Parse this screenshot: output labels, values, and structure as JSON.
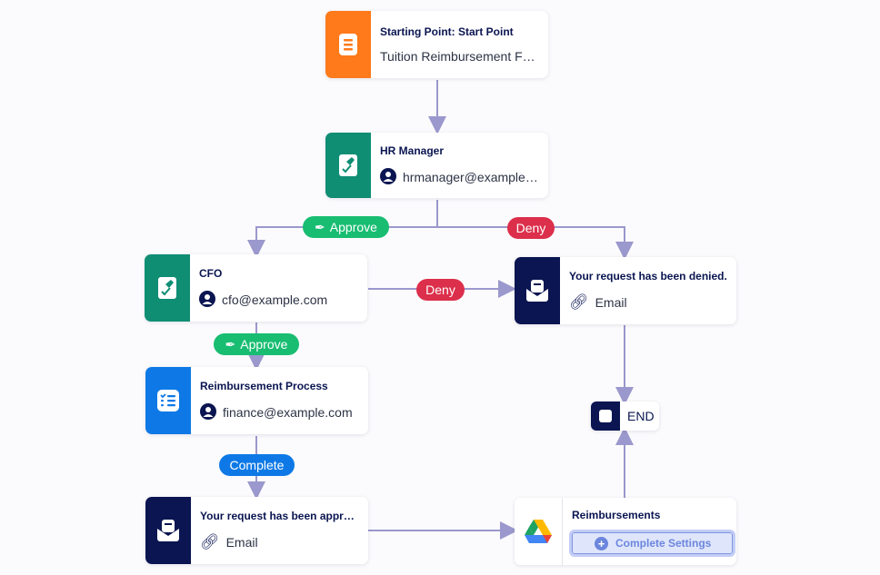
{
  "nodes": {
    "start": {
      "title": "Starting Point: Start Point",
      "subtitle": "Tuition Reimbursement Fo...",
      "icon": "form-icon",
      "color": "#ff7a1a"
    },
    "hr": {
      "title": "HR Manager",
      "subtitle": "hrmanager@example....",
      "icon": "approval-icon",
      "color": "#0f8e74"
    },
    "cfo": {
      "title": "CFO",
      "subtitle": "cfo@example.com",
      "icon": "approval-icon",
      "color": "#0f8e74"
    },
    "denied": {
      "title": "Your request has been denied.",
      "subtitle": "Email",
      "icon": "email-icon",
      "color": "#0a1551"
    },
    "process": {
      "title": "Reimbursement Process",
      "subtitle": "finance@example.com",
      "icon": "task-list-icon",
      "color": "#0e79e6"
    },
    "approved": {
      "title": "Your request has been appro...",
      "subtitle": "Email",
      "icon": "email-icon",
      "color": "#0a1551"
    },
    "drive": {
      "title": "Reimbursements",
      "button": "Complete Settings",
      "icon": "google-drive-icon"
    },
    "end": {
      "label": "END"
    }
  },
  "edges": {
    "hr_approve": "Approve",
    "hr_deny": "Deny",
    "cfo_deny": "Deny",
    "cfo_approve": "Approve",
    "process_complete": "Complete"
  }
}
